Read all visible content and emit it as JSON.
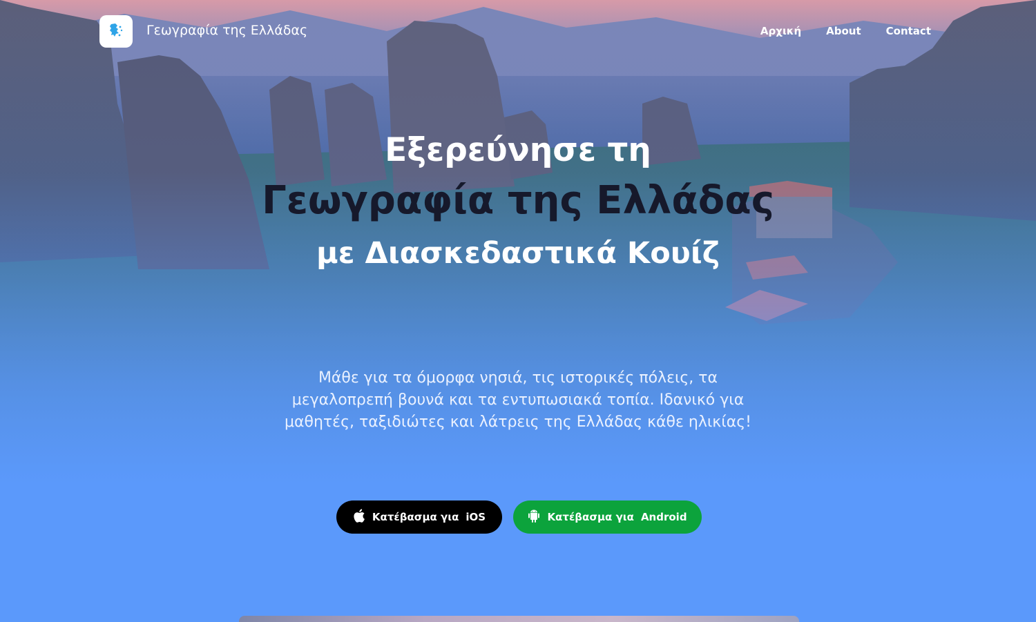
{
  "header": {
    "brand": "Γεωγραφία της Ελλάδας",
    "logo_icon": "greece-map-icon",
    "nav": [
      {
        "label": "Αρχική"
      },
      {
        "label": "About"
      },
      {
        "label": "Contact"
      }
    ]
  },
  "hero": {
    "line1": "Εξερεύνησε τη",
    "line2": "Γεωγραφία της Ελλάδας",
    "line3": "με Διασκεδαστικά Κουίζ",
    "description": "Μάθε για τα όμορφα νησιά, τις ιστορικές πόλεις, τα μεγαλοπρεπή βουνά και τα εντυπωσιακά τοπία. Ιδανικό για μαθητές, ταξιδιώτες και λάτρεις της Ελλάδας κάθε ηλικίας!"
  },
  "buttons": {
    "ios": {
      "prefix": "Κατέβασμα για",
      "platform": "iOS",
      "icon": "apple-icon",
      "color": "#000000"
    },
    "android": {
      "prefix": "Κατέβασμα για",
      "platform": "Android",
      "icon": "android-icon",
      "color": "#0ca33c"
    }
  },
  "colors": {
    "background": "#5b99fb",
    "hero_dark_text": "#16192b"
  }
}
